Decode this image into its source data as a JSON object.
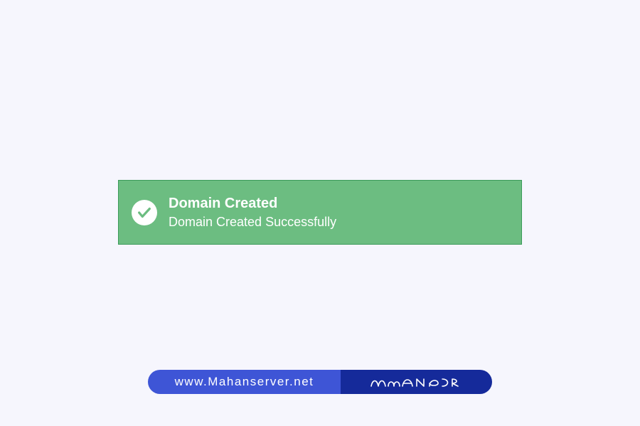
{
  "alert": {
    "title": "Domain Created",
    "message": "Domain Created Successfully"
  },
  "footer": {
    "url": "www.Mahanserver.net"
  },
  "colors": {
    "success_bg": "#6cbd81",
    "success_border": "#3a9a5a",
    "footer_light": "#3e55d6",
    "footer_dark": "#152a9a"
  }
}
